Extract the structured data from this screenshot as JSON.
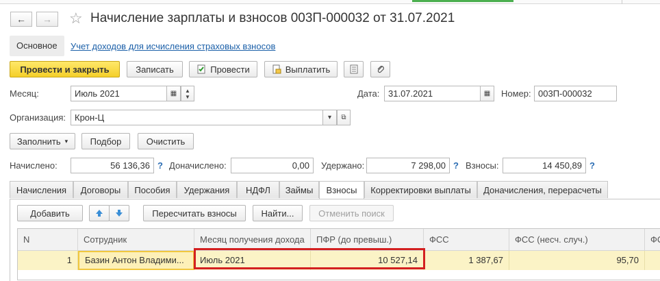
{
  "header": {
    "title": "Начисление зарплаты и взносов 003П-000032 от 31.07.2021",
    "back_symbol": "←",
    "forward_symbol": "→"
  },
  "subtabs": {
    "main": "Основное",
    "link": "Учет доходов для исчисления страховых взносов"
  },
  "toolbar": {
    "post_close": "Провести и закрыть",
    "save": "Записать",
    "post": "Провести",
    "pay": "Выплатить"
  },
  "fields": {
    "month_label": "Месяц:",
    "month_value": "Июль 2021",
    "date_label": "Дата:",
    "date_value": "31.07.2021",
    "number_label": "Номер:",
    "number_value": "003П-000032",
    "org_label": "Организация:",
    "org_value": "Крон-Ц"
  },
  "actions": {
    "fill": "Заполнить",
    "select": "Подбор",
    "clear": "Очистить"
  },
  "totals": {
    "accrued_label": "Начислено:",
    "accrued_value": "56 136,36",
    "additional_label": "Доначислено:",
    "additional_value": "0,00",
    "withheld_label": "Удержано:",
    "withheld_value": "7 298,00",
    "contrib_label": "Взносы:",
    "contrib_value": "14 450,89",
    "q": "?"
  },
  "tabs": [
    "Начисления",
    "Договоры",
    "Пособия",
    "Удержания",
    "НДФЛ",
    "Займы",
    "Взносы",
    "Корректировки выплаты",
    "Доначисления, перерасчеты"
  ],
  "tab_toolbar": {
    "add": "Добавить",
    "recalc": "Пересчитать взносы",
    "find": "Найти...",
    "cancel_search": "Отменить поиск"
  },
  "table": {
    "headers": [
      "N",
      "Сотрудник",
      "Месяц получения дохода",
      "ПФР (до превыш.)",
      "ФСС",
      "ФСС (несч. случ.)",
      "ФС"
    ],
    "rows": [
      [
        "1",
        "Базин Антон Владими...",
        "Июль 2021",
        "10 527,14",
        "1 387,67",
        "95,70",
        ""
      ]
    ]
  },
  "colors": {
    "accent_yellow": "#f4cf2a",
    "row_highlight": "#fbf3c6",
    "annotation_red": "#d32020",
    "link_blue": "#1a5fa8"
  }
}
